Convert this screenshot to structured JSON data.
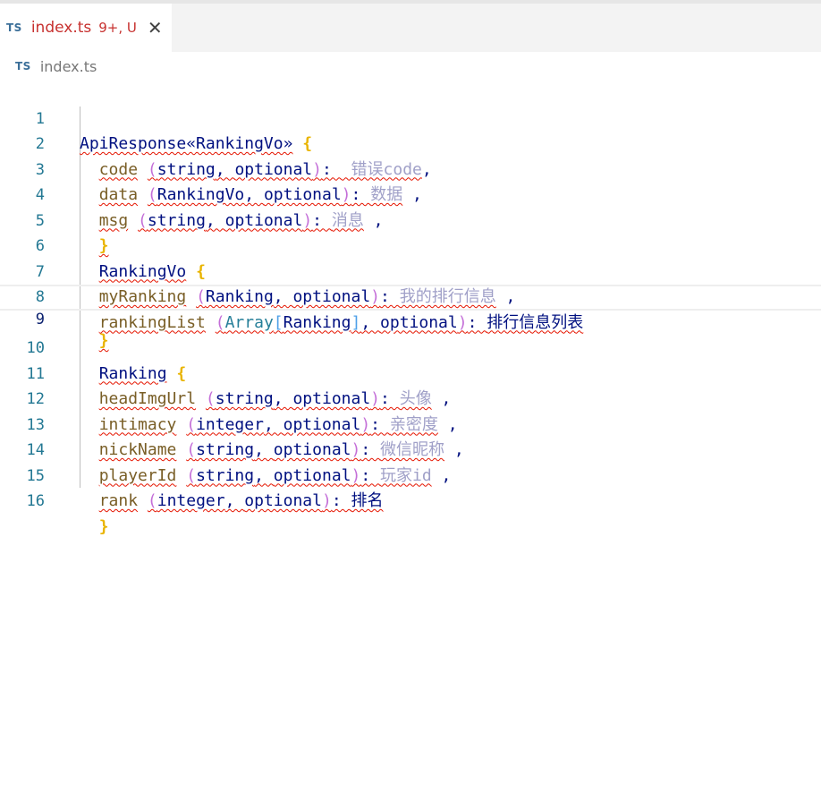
{
  "tab": {
    "badge": "TS",
    "filename": "index.ts",
    "status": "9+, U",
    "close_glyph": "✕"
  },
  "breadcrumb": {
    "badge": "TS",
    "filename": "index.ts"
  },
  "editor": {
    "line_numbers": [
      "1",
      "2",
      "3",
      "4",
      "5",
      "6",
      "7",
      "8",
      "9",
      "10",
      "11",
      "12",
      "13",
      "14",
      "15",
      "16"
    ],
    "current_line": 9,
    "lines": {
      "l1": {
        "name": "ApiResponse«RankingVo»",
        "brace": "{"
      },
      "l2": {
        "prop": "code",
        "open": "(",
        "t1": "string",
        "sep": ", ",
        "t2": "optional",
        "close": ")",
        "colon": ": ",
        "desc": " 错误code",
        "tail": ","
      },
      "l3": {
        "prop": "data",
        "open": "(",
        "t1": "RankingVo",
        "sep": ", ",
        "t2": "optional",
        "close": ")",
        "colon": ": ",
        "desc": "数据",
        "tail": " ,"
      },
      "l4": {
        "prop": "msg",
        "open": "(",
        "t1": "string",
        "sep": ", ",
        "t2": "optional",
        "close": ")",
        "colon": ": ",
        "desc": "消息",
        "tail": " ,"
      },
      "l5": {
        "brace": "}"
      },
      "l6": {
        "name": "RankingVo",
        "brace": "{"
      },
      "l7": {
        "prop": "myRanking",
        "open": "(",
        "t1": "Ranking",
        "sep": ", ",
        "t2": "optional",
        "close": ")",
        "colon": ": ",
        "desc": "我的排行信息",
        "tail": " ,"
      },
      "l8": {
        "prop": "rankingList",
        "open": "(",
        "arr": "Array",
        "lb": "[",
        "t1": "Ranking",
        "rb": "]",
        "sep": ", ",
        "t2": "optional",
        "close": ")",
        "colon": ": ",
        "desc": "排行信息列表"
      },
      "l9": {
        "brace": "}"
      },
      "l10": {
        "name": "Ranking",
        "brace": "{"
      },
      "l11": {
        "prop": "headImgUrl",
        "open": "(",
        "t1": "string",
        "sep": ", ",
        "t2": "optional",
        "close": ")",
        "colon": ": ",
        "desc": "头像",
        "tail": " ,"
      },
      "l12": {
        "prop": "intimacy",
        "open": "(",
        "t1": "integer",
        "sep": ", ",
        "t2": "optional",
        "close": ")",
        "colon": ": ",
        "desc": "亲密度",
        "tail": " ,"
      },
      "l13": {
        "prop": "nickName",
        "open": "(",
        "t1": "string",
        "sep": ", ",
        "t2": "optional",
        "close": ")",
        "colon": ": ",
        "desc": "微信昵称",
        "tail": " ,"
      },
      "l14": {
        "prop": "playerId",
        "open": "(",
        "t1": "string",
        "sep": ", ",
        "t2": "optional",
        "close": ")",
        "colon": ": ",
        "desc": "玩家id",
        "tail": " ,"
      },
      "l15": {
        "prop": "rank",
        "open": "(",
        "t1": "integer",
        "sep": ", ",
        "t2": "optional",
        "close": ")",
        "colon": ": ",
        "desc": "排名"
      },
      "l16": {
        "brace": "}"
      }
    }
  },
  "colors": {
    "error_red": "#c7312f",
    "squiggle": "#e51400",
    "type_blue": "#001080",
    "prop_brown": "#795e26",
    "bracket_gold": "#e9b400",
    "bracket_purple": "#c46fd8",
    "line_number": "#237893"
  }
}
